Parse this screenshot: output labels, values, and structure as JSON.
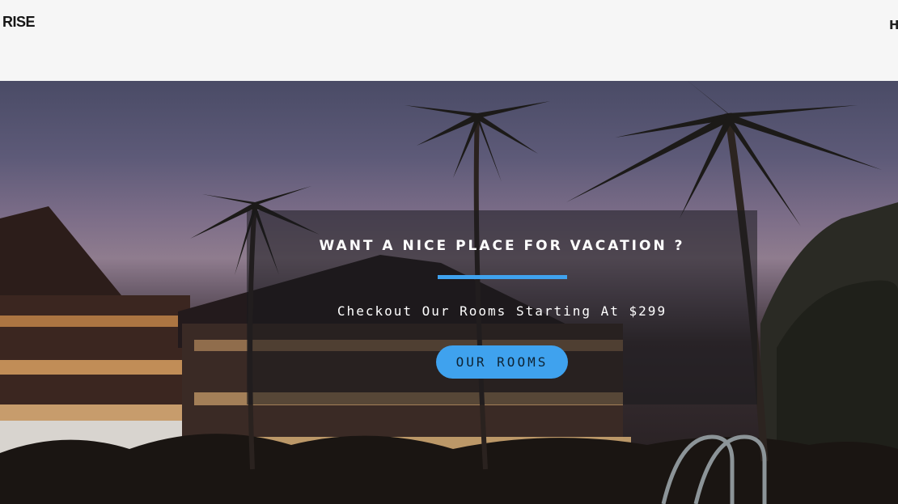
{
  "navbar": {
    "logo": "RISE",
    "menu": [
      "H"
    ]
  },
  "hero": {
    "title": "WANT A NICE PLACE FOR VACATION ?",
    "subtitle": "Checkout Our Rooms Starting At $299",
    "cta_label": "OUR ROOMS"
  },
  "colors": {
    "accent": "#3fa2ee",
    "navbar_bg": "#f6f6f6",
    "overlay": "rgba(25,25,30,0.55)"
  }
}
